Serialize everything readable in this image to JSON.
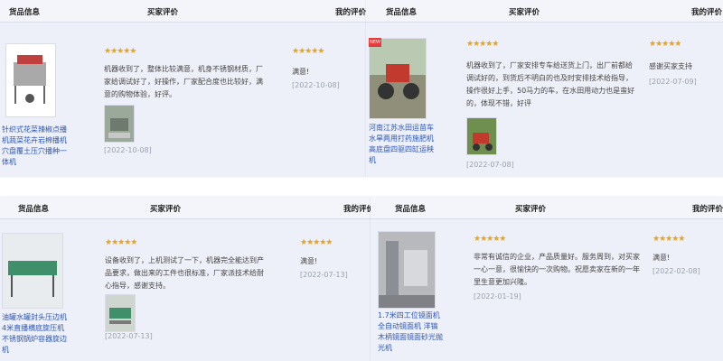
{
  "headers": {
    "goods": "货品信息",
    "buyer_review": "买家评价",
    "my_review": "我的评价"
  },
  "stars": "★★★★★",
  "reviews": [
    {
      "product": "针织式花菜辣椒点播机蔬菜花卉岩棉播机穴盘覆土压穴播种一体机",
      "text": "机器收到了，整体比较满意，机身不锈钢材质，厂家给调试好了，好操作，厂家配合度也比较好，满意的购物体验，好评。",
      "review_date": "[2022-10-08]",
      "reply": "满意!",
      "reply_date": "[2022-10-08]",
      "has_review_image": true,
      "badge": ""
    },
    {
      "product": "河南江苏水田运苗车水旱两用打药施肥机高底盘四驱四缸运秧机",
      "text": "机器收到了，厂家安排专车给送货上门，出厂前都给调试好的，到货后不明白的也及时安排技术给指导，操作很好上手，50马力的车，在水田用动力也是蛮好的，体现不错，好评",
      "review_date": "[2022-07-08]",
      "reply": "感谢买家支持",
      "reply_date": "[2022-07-09]",
      "has_review_image": true,
      "badge": "NEW"
    },
    {
      "product": "油罐水罐封头压边机4米直播横底旋压机不锈钢锅炉容器旋边机",
      "text": "设备收到了，上机测试了一下，机器完全能达到产品要求，做出来的工件也很标准，厂家派技术给耐心指导，感谢支持。",
      "review_date": "[2022-07-13]",
      "reply": "满意!",
      "reply_date": "[2022-07-13]",
      "has_review_image": true,
      "badge": ""
    },
    {
      "product": "1.7米四工位镜面机全自动镜面机 洋镐木柄镜面镜面砂光抛光机",
      "text": "非常有诚信的企业，产品质量好。服务周到，对买家一心一意，很愉快的一次购物。祝愿卖家在新的一年里生意更加兴隆。",
      "review_date": "[2022-01-19]",
      "reply": "满意!",
      "reply_date": "[2022-02-08]",
      "has_review_image": false,
      "badge": ""
    }
  ]
}
